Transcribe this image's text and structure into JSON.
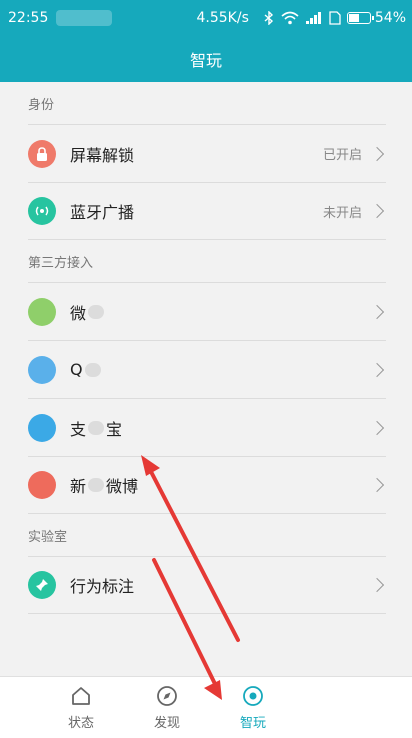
{
  "status_bar": {
    "time": "22:55",
    "speed": "4.55K/s",
    "battery": "54%",
    "battery_level": 0.54
  },
  "title_bar": {
    "title": "智玩"
  },
  "sections": {
    "identity": {
      "header": "身份",
      "items": [
        {
          "label": "屏幕解锁",
          "status": "已开启",
          "color": "#ef7a6a"
        },
        {
          "label": "蓝牙广播",
          "status": "未开启",
          "color": "#27c4a0"
        }
      ]
    },
    "third_party": {
      "header": "第三方接入",
      "items": [
        {
          "label_start": "微",
          "label_end": "",
          "color": "#8fcf6a"
        },
        {
          "label_start": "Q",
          "label_end": "",
          "color": "#5ab0ea"
        },
        {
          "label_start": "支",
          "label_end": "宝",
          "color": "#3ba9e6"
        },
        {
          "label_start": "新",
          "label_end": "微博",
          "color": "#ee6b5c"
        }
      ]
    },
    "lab": {
      "header": "实验室",
      "items": [
        {
          "label": "行为标注",
          "color": "#27c4a0"
        }
      ]
    }
  },
  "tabs": {
    "status": "状态",
    "discover": "发现",
    "smart": "智玩",
    "active_color": "#16a9bc"
  },
  "annotation_color": "#e53935"
}
